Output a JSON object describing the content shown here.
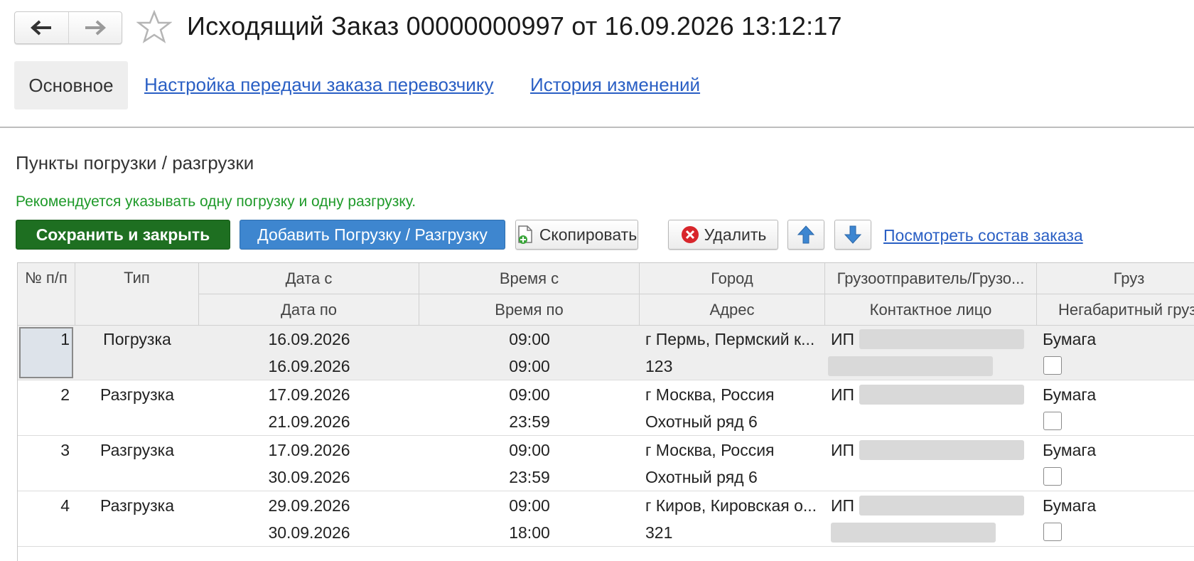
{
  "header": {
    "title": "Исходящий Заказ 00000000997 от 16.09.2026 13:12:17"
  },
  "tabs": {
    "main": "Основное",
    "carrier_settings": "Настройка передачи заказа перевозчику",
    "history": "История изменений"
  },
  "section": {
    "title": "Пункты погрузки / разгрузки",
    "hint": "Рекомендуется указывать одну погрузку и одну разгрузку."
  },
  "toolbar": {
    "save_close": "Сохранить и закрыть",
    "add_point": "Добавить Погрузку / Разгрузку",
    "copy": "Скопировать",
    "delete": "Удалить",
    "view_order": "Посмотреть состав заказа"
  },
  "colors": {
    "save": "#1e6f21",
    "add": "#3e86cf",
    "link": "#2a5fc4",
    "hint": "#1f9a2a"
  },
  "table": {
    "headers": {
      "num": "№ п/п",
      "type": "Тип",
      "date_from": "Дата с",
      "date_to": "Дата по",
      "time_from": "Время с",
      "time_to": "Время по",
      "city": "Город",
      "address": "Адрес",
      "shipper": "Грузоотправитель/Грузо...",
      "contact": "Контактное лицо",
      "cargo": "Груз",
      "oversized": "Негабаритный груз"
    },
    "rows": [
      {
        "num": "1",
        "type": "Погрузка",
        "date_from": "16.09.2026",
        "date_to": "16.09.2026",
        "time_from": "09:00",
        "time_to": "09:00",
        "city": "г Пермь,  Пермский к...",
        "address": "123",
        "shipper": "ИП",
        "cargo": "Бумага",
        "oversized": false
      },
      {
        "num": "2",
        "type": "Разгрузка",
        "date_from": "17.09.2026",
        "date_to": "21.09.2026",
        "time_from": "09:00",
        "time_to": "23:59",
        "city": "г Москва, Россия",
        "address": "Охотный ряд 6",
        "shipper": "ИП",
        "cargo": "Бумага",
        "oversized": false
      },
      {
        "num": "3",
        "type": "Разгрузка",
        "date_from": "17.09.2026",
        "date_to": "30.09.2026",
        "time_from": "09:00",
        "time_to": "23:59",
        "city": "г Москва, Россия",
        "address": "Охотный ряд 6",
        "shipper": "ИП",
        "cargo": "Бумага",
        "oversized": false
      },
      {
        "num": "4",
        "type": "Разгрузка",
        "date_from": "29.09.2026",
        "date_to": "30.09.2026",
        "time_from": "09:00",
        "time_to": "18:00",
        "city": "г Киров,  Кировская о...",
        "address": "321",
        "shipper": "ИП",
        "cargo": "Бумага",
        "oversized": false
      }
    ]
  }
}
